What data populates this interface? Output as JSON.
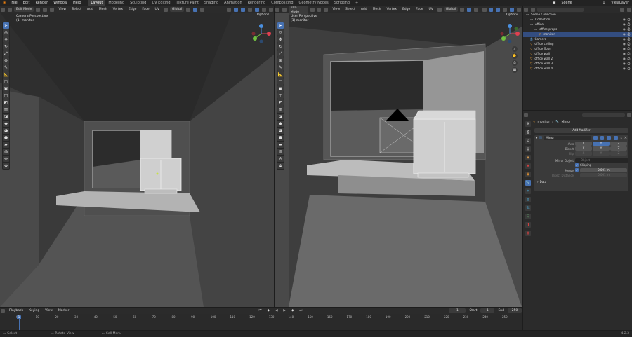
{
  "top_menu": {
    "items": [
      "File",
      "Edit",
      "Render",
      "Window",
      "Help"
    ],
    "workspaces": [
      "Layout",
      "Modeling",
      "Sculpting",
      "UV Editing",
      "Texture Paint",
      "Shading",
      "Animation",
      "Rendering",
      "Compositing",
      "Geometry Nodes",
      "Scripting"
    ],
    "active_workspace": "Layout",
    "scene_name": "Scene",
    "view_layer": "ViewLayer"
  },
  "left_viewport": {
    "mode": "Edit Mode",
    "menu": [
      "View",
      "Select",
      "Add",
      "Mesh",
      "Vertex",
      "Edge",
      "Face",
      "UV"
    ],
    "orientation": "Global",
    "title": "Camera Perspective",
    "subtitle": "(1) monitor",
    "options": "Options"
  },
  "right_viewport": {
    "mode": "Edit Mode",
    "menu": [
      "View",
      "Select",
      "Add",
      "Mesh",
      "Vertex",
      "Edge",
      "Face",
      "UV"
    ],
    "orientation": "Global",
    "title": "User Perspective",
    "subtitle": "(1) monitor",
    "options": "Options"
  },
  "outliner": {
    "search_placeholder": "",
    "rows": [
      {
        "label": "Scene Collection",
        "indent": 0,
        "icon": "collection-icon"
      },
      {
        "label": "Collection",
        "indent": 1,
        "icon": "collection-icon"
      },
      {
        "label": "office",
        "indent": 1,
        "icon": "collection-icon"
      },
      {
        "label": "office props",
        "indent": 2,
        "icon": "collection-icon"
      },
      {
        "label": "monitor",
        "indent": 3,
        "icon": "mesh-icon",
        "selected": true
      },
      {
        "label": "Camera",
        "indent": 1,
        "icon": "camera-icon"
      },
      {
        "label": "office ceiling",
        "indent": 1,
        "icon": "mesh-icon"
      },
      {
        "label": "office floor",
        "indent": 1,
        "icon": "mesh-icon"
      },
      {
        "label": "office wall",
        "indent": 1,
        "icon": "mesh-icon"
      },
      {
        "label": "office wall 2",
        "indent": 1,
        "icon": "mesh-icon"
      },
      {
        "label": "office wall 3",
        "indent": 1,
        "icon": "mesh-icon"
      },
      {
        "label": "office wall 4",
        "indent": 1,
        "icon": "mesh-icon"
      }
    ]
  },
  "properties": {
    "object_name": "monitor",
    "modifier_tab": "Mirror",
    "add_modifier": "Add Modifier",
    "modifier_name": "Mirror",
    "axis_label": "Axis",
    "bisect_label": "Bisect",
    "flip_label": "Flip",
    "axes": [
      "X",
      "Y",
      "Z"
    ],
    "mirror_object_label": "Mirror Object",
    "mirror_object_placeholder": "Object",
    "clipping_label": "Clipping",
    "merge_label": "Merge",
    "merge_value": "0.001 m",
    "bisect_distance_label": "Bisect Distance",
    "bisect_distance_value": "0.001 m",
    "data_label": "Data"
  },
  "timeline": {
    "menu": [
      "Playback",
      "Keying",
      "View",
      "Marker"
    ],
    "current_frame": "1",
    "start_label": "Start",
    "start_value": "1",
    "end_label": "End",
    "end_value": "250",
    "ticks": [
      "0",
      "10",
      "20",
      "30",
      "40",
      "50",
      "60",
      "70",
      "80",
      "90",
      "100",
      "110",
      "120",
      "130",
      "140",
      "150",
      "160",
      "170",
      "180",
      "190",
      "200",
      "210",
      "220",
      "230",
      "240",
      "250"
    ]
  },
  "statusbar": {
    "select": "Select",
    "rotate": "Rotate View",
    "call_menu": "Call Menu",
    "version": "4.2.3"
  },
  "colors": {
    "accent": "#4772b3",
    "selected_row": "#334d80",
    "mesh_icon": "#f0a030",
    "vertex_icon": "#6fd27a"
  }
}
